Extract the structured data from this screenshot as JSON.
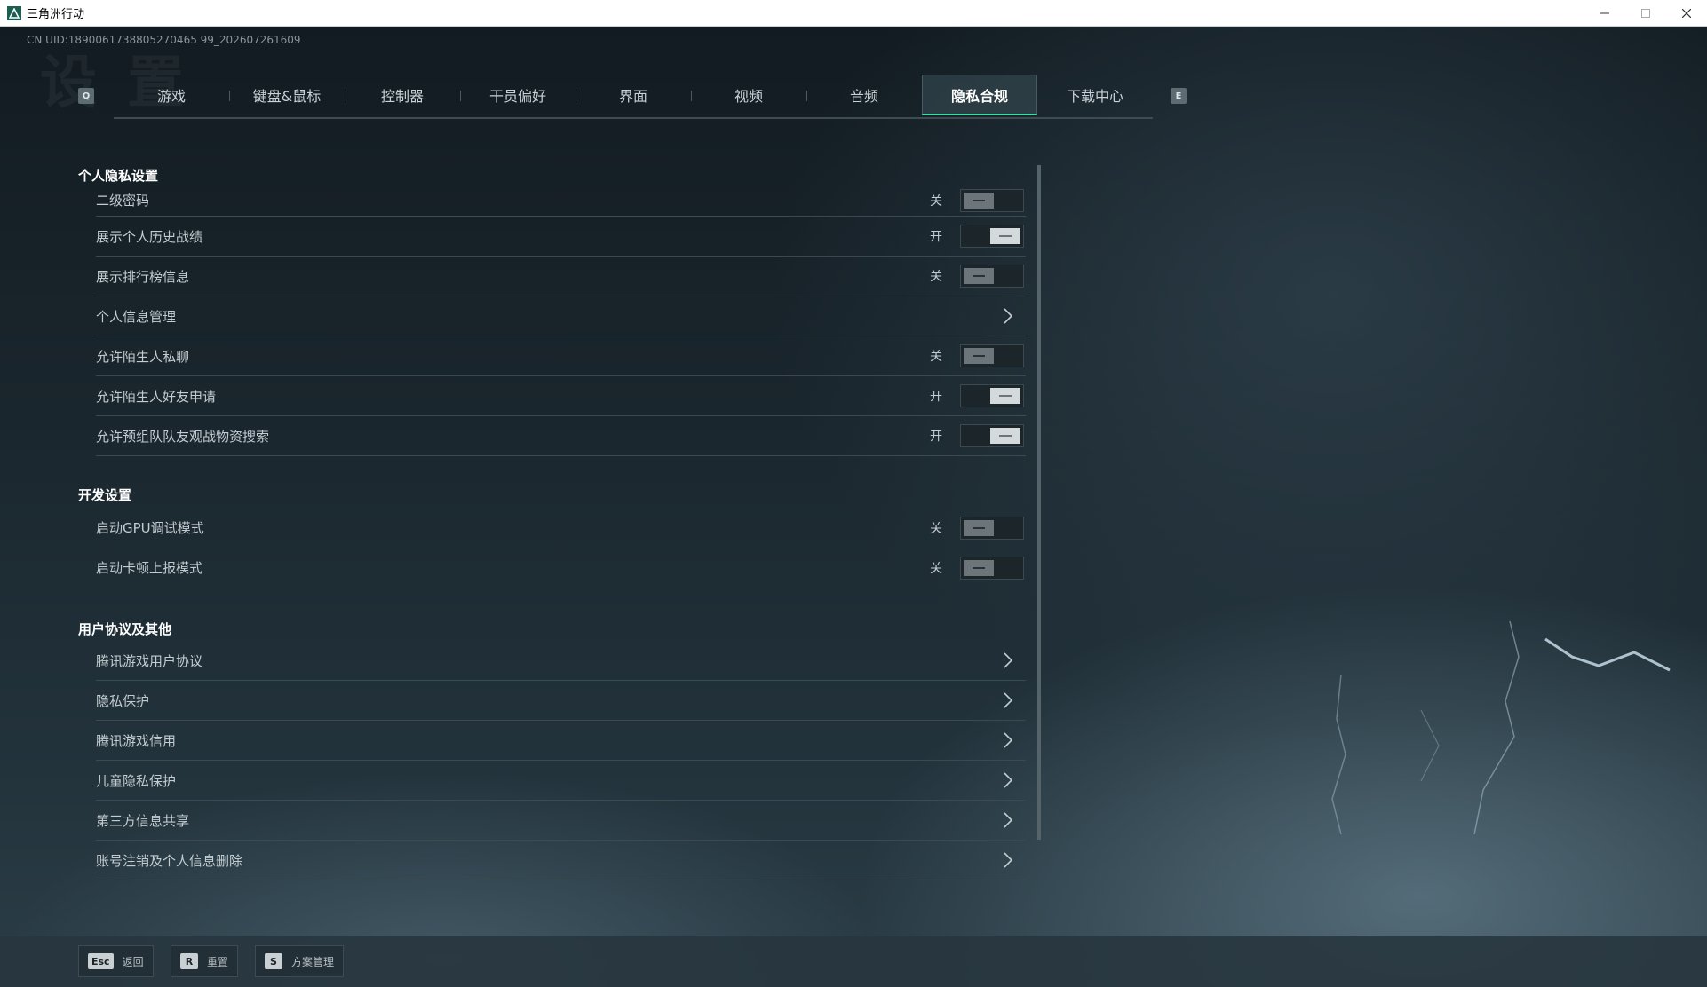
{
  "window": {
    "title": "三角洲行动",
    "icons": {
      "app": "delta-force-icon",
      "minimize": "minimize-icon",
      "maximize": "maximize-icon",
      "close": "close-icon"
    }
  },
  "uid": "CN UID:1890061738805270465 99_202607261609",
  "tabs": {
    "prev_key": "Q",
    "next_key": "E",
    "items": [
      {
        "label": "游戏",
        "active": false
      },
      {
        "label": "键盘&鼠标",
        "active": false
      },
      {
        "label": "控制器",
        "active": false
      },
      {
        "label": "干员偏好",
        "active": false
      },
      {
        "label": "界面",
        "active": false
      },
      {
        "label": "视频",
        "active": false
      },
      {
        "label": "音频",
        "active": false
      },
      {
        "label": "隐私合规",
        "active": true
      },
      {
        "label": "下载中心",
        "active": false
      }
    ]
  },
  "sections": {
    "privacy": {
      "title": "个人隐私设置",
      "rows": [
        {
          "label": "二级密码",
          "state": "关",
          "on": false
        },
        {
          "label": "展示个人历史战绩",
          "state": "开",
          "on": true
        },
        {
          "label": "展示排行榜信息",
          "state": "关",
          "on": false
        },
        {
          "label": "个人信息管理"
        },
        {
          "label": "允许陌生人私聊",
          "state": "关",
          "on": false
        },
        {
          "label": "允许陌生人好友申请",
          "state": "开",
          "on": true
        },
        {
          "label": "允许预组队队友观战物资搜索",
          "state": "开",
          "on": true
        }
      ]
    },
    "dev": {
      "title": "开发设置",
      "rows": [
        {
          "label": "启动GPU调试模式",
          "state": "关",
          "on": false
        },
        {
          "label": "启动卡顿上报模式",
          "state": "关",
          "on": false
        }
      ]
    },
    "agreements": {
      "title": "用户协议及其他",
      "rows": [
        {
          "label": "腾讯游戏用户协议"
        },
        {
          "label": "隐私保护"
        },
        {
          "label": "腾讯游戏信用"
        },
        {
          "label": "儿童隐私保护"
        },
        {
          "label": "第三方信息共享"
        },
        {
          "label": "账号注销及个人信息删除"
        }
      ]
    }
  },
  "bottom": {
    "buttons": [
      {
        "key": "Esc",
        "label": "返回"
      },
      {
        "key": "R",
        "label": "重置"
      },
      {
        "key": "S",
        "label": "方案管理"
      }
    ]
  },
  "colors": {
    "accent": "#3fd9a5",
    "panel": "#1c2529"
  }
}
